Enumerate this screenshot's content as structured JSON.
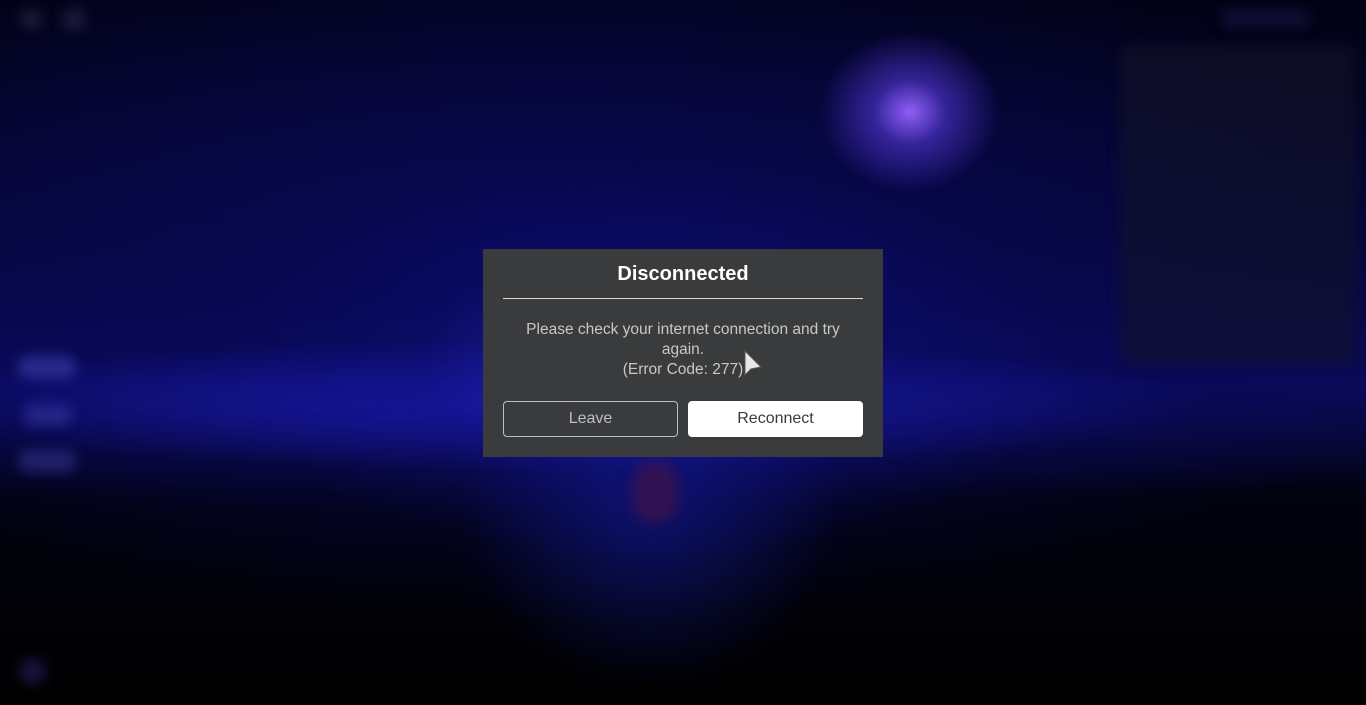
{
  "dialog": {
    "title": "Disconnected",
    "message_line1": "Please check your internet connection and try again.",
    "message_line2": "(Error Code: 277)",
    "leave_label": "Leave",
    "reconnect_label": "Reconnect"
  },
  "icons": {
    "cursor": "mouse-pointer-icon"
  },
  "colors": {
    "dialog_background": "#393b3d",
    "primary_button": "#ffffff",
    "title_text": "#ffffff",
    "message_text": "#c8c8c8"
  }
}
